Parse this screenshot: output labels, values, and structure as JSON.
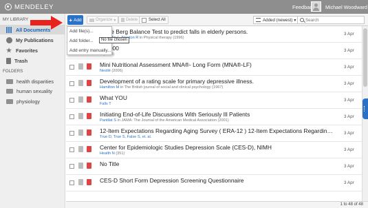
{
  "header": {
    "logo_text": "MENDELEY",
    "feedback_label": "Feedback",
    "user_name": "Michael Woodward"
  },
  "sidebar": {
    "library_heading": "MY LIBRARY",
    "library_items": [
      {
        "label": "All Documents",
        "icon": "books-icon"
      },
      {
        "label": "My Publications",
        "icon": "publications-icon"
      },
      {
        "label": "Favorites",
        "icon": "star-icon"
      },
      {
        "label": "Trash",
        "icon": "trash-icon"
      }
    ],
    "folders_heading": "FOLDERS",
    "folders": [
      {
        "label": "health disparities"
      },
      {
        "label": "human sexuality"
      },
      {
        "label": "physiology"
      }
    ]
  },
  "toolbar": {
    "add_label": "Add",
    "organize_label": "Organize",
    "delete_label": "Delete",
    "select_all_label": "Select All",
    "sort_label": "Added (newest)",
    "search_placeholder": "Search"
  },
  "add_menu": {
    "items": [
      "Add file(s)...",
      "Add folder...",
      "Add entry manually..."
    ],
    "tooltip": "No file chosen"
  },
  "documents": [
    {
      "title": "of the Berg Balance Test to predict falls in elderly persons.",
      "authors": "Thorbahn L, Newton R",
      "source": " in Physical therapy (1996)",
      "date": "3 Apr"
    },
    {
      "title": "et 2000",
      "authors": "",
      "source": "A (2000)",
      "date": "3 Apr"
    },
    {
      "title": "Mini Nutritional Assessment MNA®- Long Form (MNA®-LF)",
      "authors": "Nestlé",
      "source": " (2006)",
      "date": "3 Apr"
    },
    {
      "title": "Development of a rating scale for primary depressive illness.",
      "authors": "Hamilton M",
      "source": " in The British journal of social and clinical psychology (1967)",
      "date": "3 Apr"
    },
    {
      "title": "What YOU",
      "authors": "Falls T",
      "source": "",
      "date": "3 Apr"
    },
    {
      "title": "Initiating End-of-Life Discussions With Seriously Ill Patients",
      "authors": "Pantilat S",
      "source": " in JAMA: The Journal of the American Medical Association (2001)",
      "date": "3 Apr"
    },
    {
      "title": "12-Item Expectations Regarding Aging Survey ( ERA-12 ) 12-Item Expectations Regarding Aging Surve...",
      "authors": "True D, True S, False S, et. al.",
      "source": "",
      "date": "3 Apr"
    },
    {
      "title": "Center for Epidemiologic Studies Depression Scale (CES-D), NIMH",
      "authors": "Health N",
      "source": " (351)",
      "date": "3 Apr"
    },
    {
      "title": "No Title",
      "authors": "",
      "source": "",
      "date": "3 Apr"
    },
    {
      "title": "CES-D Short Form Depression Screening Questionnaire",
      "authors": "",
      "source": "",
      "date": "3 Apr"
    }
  ],
  "footer": {
    "pager_text": "1 to 48 of 48"
  },
  "colors": {
    "accent": "#2a72c7",
    "topbar": "#8e8e8e",
    "arrow": "#e8231e"
  }
}
